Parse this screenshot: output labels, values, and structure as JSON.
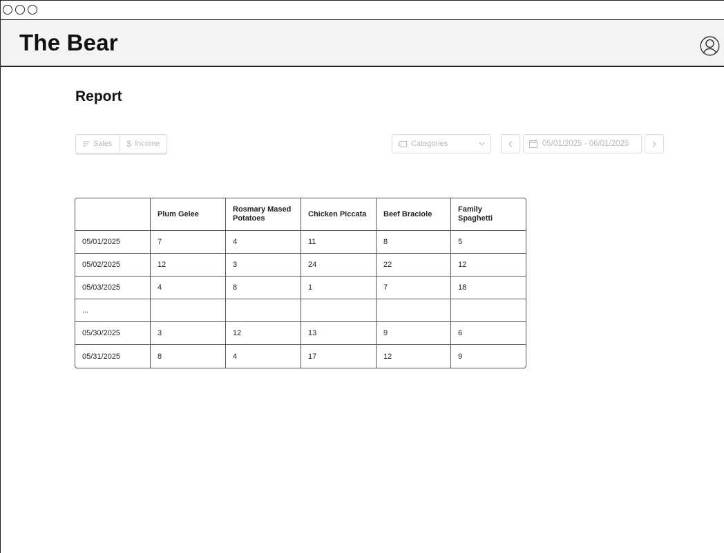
{
  "app": {
    "title": "The Bear"
  },
  "page": {
    "title": "Report"
  },
  "toolbar": {
    "tabs": [
      {
        "label": "Sales",
        "icon": "list-icon"
      },
      {
        "label": "Income",
        "icon": "dollar-icon"
      }
    ],
    "category_filter": {
      "placeholder": "Categories",
      "icon": "tag-icon"
    },
    "date_range": {
      "value": "05/01/2025 - 06/01/2025",
      "icon": "calendar-icon"
    }
  },
  "table": {
    "columns": [
      "",
      "Plum Gelee",
      "Rosmary Mased Potatoes",
      "Chicken Piccata",
      "Beef Braciole",
      "Family Spaghetti"
    ],
    "rows": [
      [
        "05/01/2025",
        "7",
        "4",
        "11",
        "8",
        "5"
      ],
      [
        "05/02/2025",
        "12",
        "3",
        "24",
        "22",
        "12"
      ],
      [
        "05/03/2025",
        "4",
        "8",
        "1",
        "7",
        "18"
      ],
      [
        "...",
        "",
        "",
        "",
        "",
        ""
      ],
      [
        "05/30/2025",
        "3",
        "12",
        "13",
        "9",
        "6"
      ],
      [
        "05/31/2025",
        "8",
        "4",
        "17",
        "12",
        "9"
      ]
    ]
  },
  "colors": {
    "border": "#222222",
    "header_bg": "#f3f3f4",
    "muted": "#b8b8b8"
  }
}
